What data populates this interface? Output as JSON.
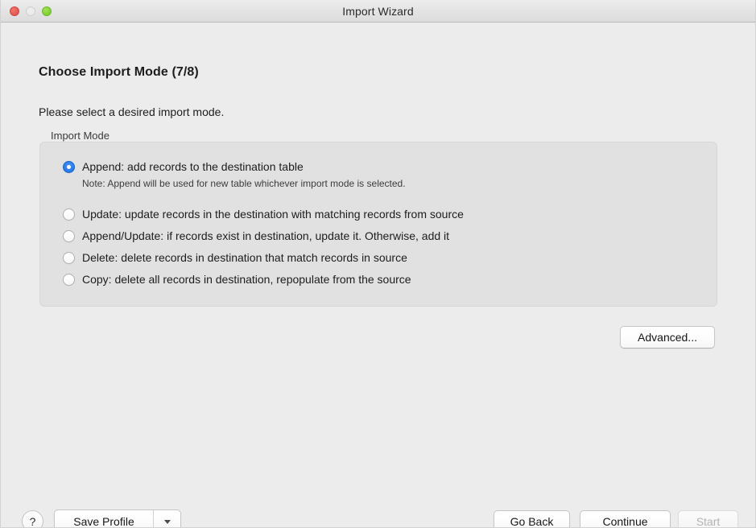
{
  "window": {
    "title": "Import Wizard",
    "traffic_lights": [
      {
        "name": "close-button",
        "color": "#e0564e"
      },
      {
        "name": "minimize-button",
        "color": "#ececec"
      },
      {
        "name": "zoom-button",
        "color": "#79ce2e"
      }
    ]
  },
  "page": {
    "heading": "Choose Import Mode (7/8)",
    "subtitle": "Please select a desired import mode."
  },
  "group": {
    "label": "Import Mode",
    "options": [
      {
        "label": "Append: add records to the destination table",
        "note": "Note: Append will be used for new table whichever import mode is selected.",
        "selected": true
      },
      {
        "label": "Update: update records in the destination with matching records from source",
        "note": "",
        "selected": false
      },
      {
        "label": "Append/Update: if records exist in destination, update it. Otherwise, add it",
        "note": "",
        "selected": false
      },
      {
        "label": "Delete: delete records in destination that match records in source",
        "note": "",
        "selected": false
      },
      {
        "label": "Copy: delete all records in destination, repopulate from the source",
        "note": "",
        "selected": false
      }
    ]
  },
  "buttons": {
    "advanced": "Advanced...",
    "help": "?",
    "save_profile": "Save Profile",
    "save_profile_menu_icon": "chevron-down-icon",
    "go_back": "Go Back",
    "continue": "Continue",
    "start": "Start",
    "start_disabled": true
  },
  "colors": {
    "accent": "#1f73e8",
    "window_bg": "#ececec",
    "group_bg": "#e1e1e1",
    "text": "#1d1d1d",
    "disabled_text": "#b3b3b3"
  }
}
